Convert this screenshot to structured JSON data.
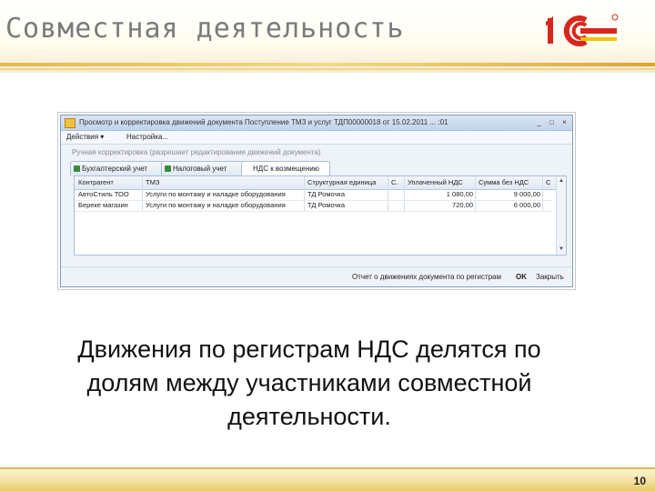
{
  "slide": {
    "title": "Совместная деятельность",
    "caption_lines": [
      "Движения по регистрам НДС делятся по",
      "долям между участниками совместной",
      "деятельности."
    ],
    "page_number": "10"
  },
  "window": {
    "title": "Просмотр и корректировка движений документа Поступление ТМЗ и услуг ТДП00000018 от 15.02.2011 ... :01",
    "controls": [
      "_",
      "□",
      "×"
    ],
    "menu": [
      "Действия ▾",
      "Настройка..."
    ],
    "hint": "Ручная корректировка (разрешает редактирование движений документа)",
    "tabs": [
      "Бухгалтерский учет",
      "Налоговый учет",
      "НДС к возмещению"
    ],
    "active_tab_index": 2,
    "columns": [
      "Контрагент",
      "ТМЗ",
      "Структурная единица",
      "С.",
      "Уплаченный НДС",
      "Сумма без НДС",
      "С"
    ],
    "rows": [
      [
        "АвтоСтиль ТОО",
        "Услуги по монтажу и наладке оборудования",
        "ТД Ромочка",
        "",
        "1 080,00",
        "9 000,00",
        ""
      ],
      [
        "Береке магазин",
        "Услуги по монтажу и наладке оборудования",
        "ТД Ромочка",
        "",
        "720,00",
        "6 000,00",
        ""
      ]
    ],
    "status": {
      "report_label": "Отчет о движениях документа по регистрам",
      "ok_label": "OK",
      "close_label": "Закрыть"
    }
  },
  "colors": {
    "accent": "#e3b94c",
    "logo_red": "#d9261c",
    "logo_yellow": "#f2c200"
  }
}
